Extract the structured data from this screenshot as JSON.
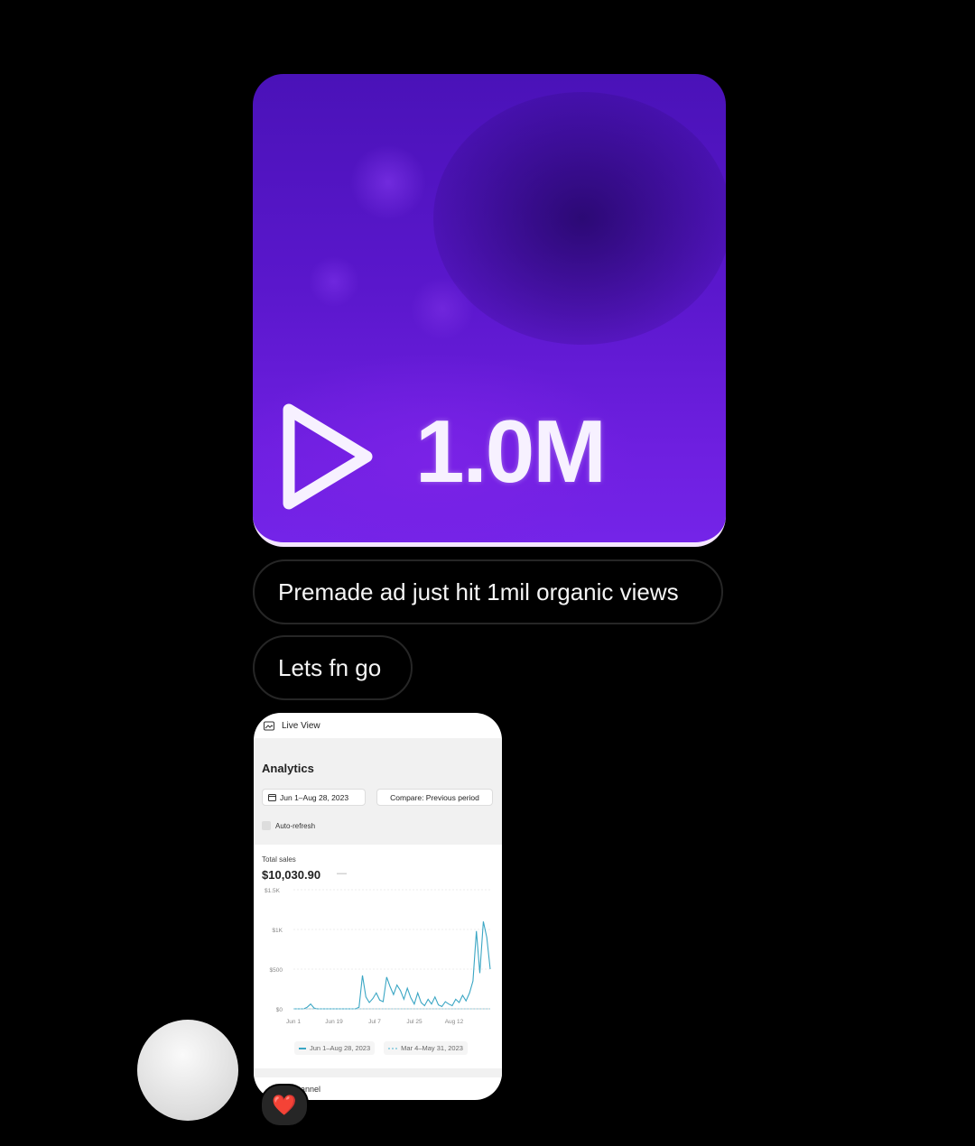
{
  "media": {
    "view_count": "1.0M",
    "icon": "play-icon"
  },
  "messages": [
    {
      "text": "Premade ad just hit 1mil organic views"
    },
    {
      "text": "Lets fn go"
    }
  ],
  "screenshot": {
    "topbar_label": "Live View",
    "title": "Analytics",
    "date_range": "Jun 1–Aug 28, 2023",
    "compare_label": "Compare: Previous period",
    "auto_refresh": "Auto-refresh",
    "metric_label": "Total sales",
    "metric_value": "$10,030.90",
    "metric_dash": "—",
    "bottom_label": "annel",
    "chart_data": {
      "type": "line",
      "y_ticks": [
        "$1.5K",
        "$1K",
        "$500",
        "$0"
      ],
      "x_ticks": [
        "Jun 1",
        "Jun 19",
        "Jul 7",
        "Jul 25",
        "Aug 12"
      ],
      "ylim": [
        0,
        1500
      ],
      "series": [
        {
          "name": "Jun 1–Aug 28, 2023",
          "color": "#3aa6c4",
          "values": [
            0,
            0,
            0,
            0,
            20,
            60,
            10,
            0,
            0,
            0,
            0,
            0,
            0,
            0,
            0,
            0,
            0,
            0,
            0,
            20,
            420,
            150,
            80,
            130,
            200,
            110,
            90,
            400,
            280,
            180,
            300,
            230,
            120,
            260,
            140,
            60,
            200,
            80,
            40,
            120,
            60,
            150,
            50,
            30,
            90,
            60,
            40,
            120,
            80,
            170,
            100,
            200,
            350,
            980,
            450,
            1100,
            900,
            500
          ]
        },
        {
          "name": "Mar 4–May 31, 2023",
          "color": "#9fd3e2",
          "values": [
            0,
            0,
            0,
            0,
            0,
            0,
            0,
            0,
            0,
            0,
            0,
            0,
            0,
            0,
            0,
            0,
            0,
            0,
            0,
            0,
            0,
            0,
            0,
            0,
            0,
            0,
            0,
            0,
            0,
            0,
            0,
            0,
            0,
            0,
            0,
            0,
            0,
            0,
            0,
            0,
            0,
            0,
            0,
            0,
            0,
            0,
            0,
            0,
            0,
            0,
            0,
            0,
            0,
            0,
            0,
            0,
            0,
            0
          ]
        }
      ]
    }
  },
  "reaction": {
    "emoji": "❤️"
  }
}
